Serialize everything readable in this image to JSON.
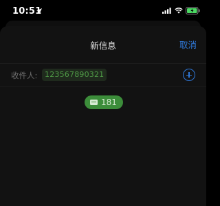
{
  "status_bar": {
    "time": "10:51",
    "icons": [
      "location-arrow-icon",
      "signal-bars-icon",
      "wifi-icon",
      "battery-charging-icon"
    ]
  },
  "compose": {
    "title": "新信息",
    "cancel_label": "取消",
    "recipient_label": "收件人:",
    "recipient": "123567890321",
    "add_contact_icon": "plus-circle-icon"
  },
  "message": {
    "icon": "sms-icon",
    "text": "181"
  },
  "colors": {
    "accent_blue": "#2f78d8",
    "bubble_green": "#3c8d3a",
    "chip_text_green": "#4f9a46",
    "battery_green": "#4cd964"
  }
}
